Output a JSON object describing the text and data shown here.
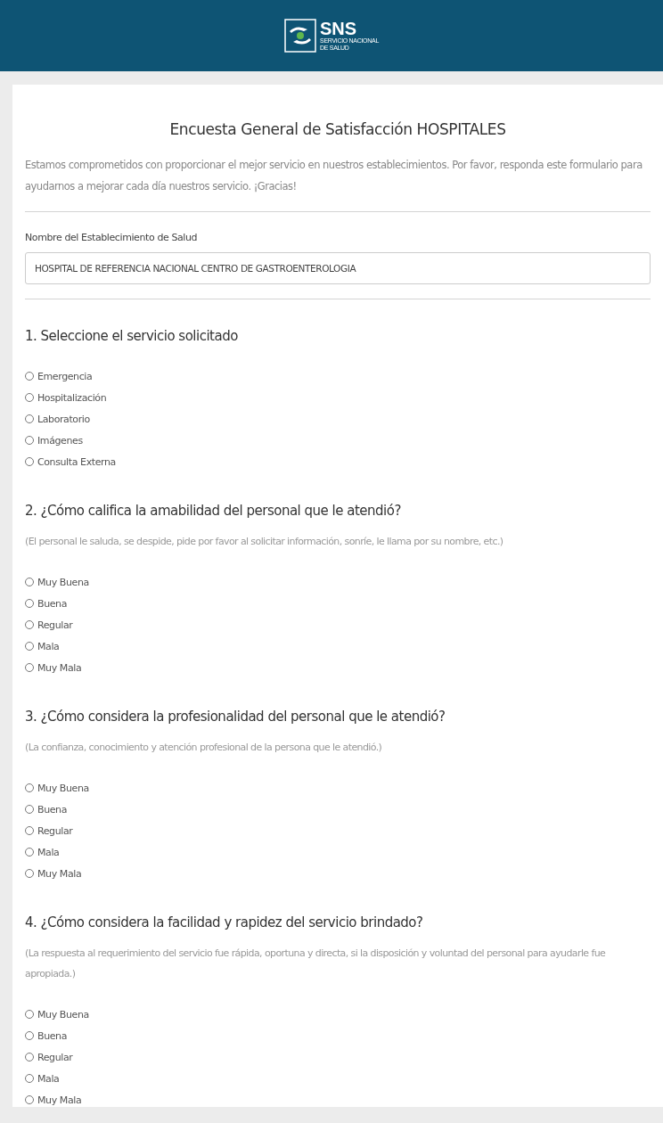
{
  "header": {
    "logo": {
      "title": "SNS",
      "subtitle_lines": [
        "SERVICIO NACIONAL",
        "DE SALUD"
      ]
    }
  },
  "form": {
    "title": "Encuesta General de Satisfacción HOSPITALES",
    "description": "Estamos comprometidos con proporcionar el mejor servicio en nuestros establecimientos. Por favor, responda este formulario para ayudarnos a mejorar cada día nuestros servicio. ¡Gracias!",
    "establishment": {
      "label": "Nombre del Establecimiento de Salud",
      "value": "HOSPITAL DE REFERENCIA NACIONAL CENTRO DE GASTROENTEROLOGIA"
    },
    "questions": [
      {
        "title": "1. Seleccione el servicio solicitado",
        "options": [
          {
            "label": "Emergencia",
            "selected": false
          },
          {
            "label": "Hospitalización",
            "selected": false
          },
          {
            "label": "Laboratorio",
            "selected": false
          },
          {
            "label": "Imágenes",
            "selected": false
          },
          {
            "label": "Consulta Externa",
            "selected": false
          }
        ]
      },
      {
        "title": "2. ¿Cómo califica la amabilidad del personal que le atendió?",
        "hint": "(El personal le saluda, se despide, pide por favor al solicitar información, sonríe, le llama por su nombre, etc.)",
        "options": [
          {
            "label": "Muy Buena",
            "selected": false
          },
          {
            "label": "Buena",
            "selected": false
          },
          {
            "label": "Regular",
            "selected": false
          },
          {
            "label": "Mala",
            "selected": false
          },
          {
            "label": "Muy Mala",
            "selected": false
          }
        ]
      },
      {
        "title": "3. ¿Cómo considera la profesionalidad del personal que le atendió?",
        "hint": "(La confianza, conocimiento y atención profesional de la persona que le atendió.)",
        "options": [
          {
            "label": "Muy Buena",
            "selected": false
          },
          {
            "label": "Buena",
            "selected": false
          },
          {
            "label": "Regular",
            "selected": false
          },
          {
            "label": "Mala",
            "selected": false
          },
          {
            "label": "Muy Mala",
            "selected": false
          }
        ]
      },
      {
        "title": "4. ¿Cómo considera la facilidad y rapidez del servicio brindado?",
        "hint": "(La respuesta al requerimiento del servicio fue rápida, oportuna y directa, si la disposición y voluntad del personal para ayudarle fue apropiada.)",
        "options": [
          {
            "label": "Muy Buena",
            "selected": false
          },
          {
            "label": "Buena",
            "selected": false
          },
          {
            "label": "Regular",
            "selected": false
          },
          {
            "label": "Mala",
            "selected": false
          },
          {
            "label": "Muy Mala",
            "selected": false
          }
        ]
      }
    ]
  }
}
